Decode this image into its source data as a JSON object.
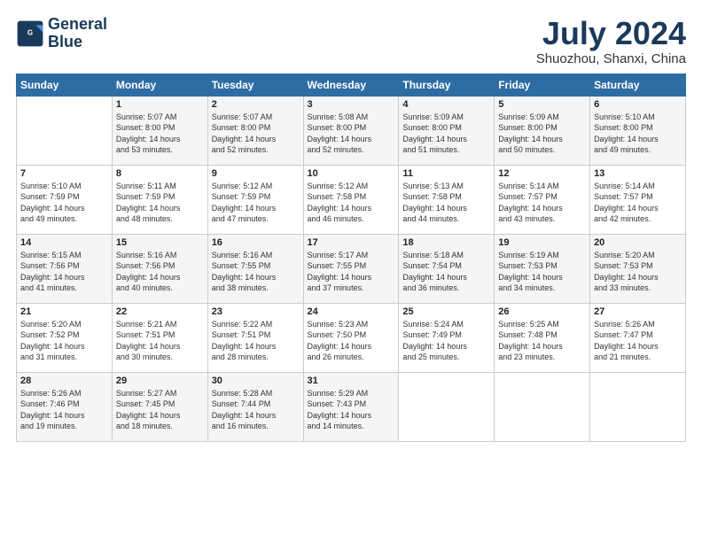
{
  "logo": {
    "line1": "General",
    "line2": "Blue"
  },
  "title": "July 2024",
  "subtitle": "Shuozhou, Shanxi, China",
  "header_days": [
    "Sunday",
    "Monday",
    "Tuesday",
    "Wednesday",
    "Thursday",
    "Friday",
    "Saturday"
  ],
  "weeks": [
    [
      {
        "num": "",
        "info": ""
      },
      {
        "num": "1",
        "info": "Sunrise: 5:07 AM\nSunset: 8:00 PM\nDaylight: 14 hours\nand 53 minutes."
      },
      {
        "num": "2",
        "info": "Sunrise: 5:07 AM\nSunset: 8:00 PM\nDaylight: 14 hours\nand 52 minutes."
      },
      {
        "num": "3",
        "info": "Sunrise: 5:08 AM\nSunset: 8:00 PM\nDaylight: 14 hours\nand 52 minutes."
      },
      {
        "num": "4",
        "info": "Sunrise: 5:09 AM\nSunset: 8:00 PM\nDaylight: 14 hours\nand 51 minutes."
      },
      {
        "num": "5",
        "info": "Sunrise: 5:09 AM\nSunset: 8:00 PM\nDaylight: 14 hours\nand 50 minutes."
      },
      {
        "num": "6",
        "info": "Sunrise: 5:10 AM\nSunset: 8:00 PM\nDaylight: 14 hours\nand 49 minutes."
      }
    ],
    [
      {
        "num": "7",
        "info": "Sunrise: 5:10 AM\nSunset: 7:59 PM\nDaylight: 14 hours\nand 49 minutes."
      },
      {
        "num": "8",
        "info": "Sunrise: 5:11 AM\nSunset: 7:59 PM\nDaylight: 14 hours\nand 48 minutes."
      },
      {
        "num": "9",
        "info": "Sunrise: 5:12 AM\nSunset: 7:59 PM\nDaylight: 14 hours\nand 47 minutes."
      },
      {
        "num": "10",
        "info": "Sunrise: 5:12 AM\nSunset: 7:58 PM\nDaylight: 14 hours\nand 46 minutes."
      },
      {
        "num": "11",
        "info": "Sunrise: 5:13 AM\nSunset: 7:58 PM\nDaylight: 14 hours\nand 44 minutes."
      },
      {
        "num": "12",
        "info": "Sunrise: 5:14 AM\nSunset: 7:57 PM\nDaylight: 14 hours\nand 43 minutes."
      },
      {
        "num": "13",
        "info": "Sunrise: 5:14 AM\nSunset: 7:57 PM\nDaylight: 14 hours\nand 42 minutes."
      }
    ],
    [
      {
        "num": "14",
        "info": "Sunrise: 5:15 AM\nSunset: 7:56 PM\nDaylight: 14 hours\nand 41 minutes."
      },
      {
        "num": "15",
        "info": "Sunrise: 5:16 AM\nSunset: 7:56 PM\nDaylight: 14 hours\nand 40 minutes."
      },
      {
        "num": "16",
        "info": "Sunrise: 5:16 AM\nSunset: 7:55 PM\nDaylight: 14 hours\nand 38 minutes."
      },
      {
        "num": "17",
        "info": "Sunrise: 5:17 AM\nSunset: 7:55 PM\nDaylight: 14 hours\nand 37 minutes."
      },
      {
        "num": "18",
        "info": "Sunrise: 5:18 AM\nSunset: 7:54 PM\nDaylight: 14 hours\nand 36 minutes."
      },
      {
        "num": "19",
        "info": "Sunrise: 5:19 AM\nSunset: 7:53 PM\nDaylight: 14 hours\nand 34 minutes."
      },
      {
        "num": "20",
        "info": "Sunrise: 5:20 AM\nSunset: 7:53 PM\nDaylight: 14 hours\nand 33 minutes."
      }
    ],
    [
      {
        "num": "21",
        "info": "Sunrise: 5:20 AM\nSunset: 7:52 PM\nDaylight: 14 hours\nand 31 minutes."
      },
      {
        "num": "22",
        "info": "Sunrise: 5:21 AM\nSunset: 7:51 PM\nDaylight: 14 hours\nand 30 minutes."
      },
      {
        "num": "23",
        "info": "Sunrise: 5:22 AM\nSunset: 7:51 PM\nDaylight: 14 hours\nand 28 minutes."
      },
      {
        "num": "24",
        "info": "Sunrise: 5:23 AM\nSunset: 7:50 PM\nDaylight: 14 hours\nand 26 minutes."
      },
      {
        "num": "25",
        "info": "Sunrise: 5:24 AM\nSunset: 7:49 PM\nDaylight: 14 hours\nand 25 minutes."
      },
      {
        "num": "26",
        "info": "Sunrise: 5:25 AM\nSunset: 7:48 PM\nDaylight: 14 hours\nand 23 minutes."
      },
      {
        "num": "27",
        "info": "Sunrise: 5:26 AM\nSunset: 7:47 PM\nDaylight: 14 hours\nand 21 minutes."
      }
    ],
    [
      {
        "num": "28",
        "info": "Sunrise: 5:26 AM\nSunset: 7:46 PM\nDaylight: 14 hours\nand 19 minutes."
      },
      {
        "num": "29",
        "info": "Sunrise: 5:27 AM\nSunset: 7:45 PM\nDaylight: 14 hours\nand 18 minutes."
      },
      {
        "num": "30",
        "info": "Sunrise: 5:28 AM\nSunset: 7:44 PM\nDaylight: 14 hours\nand 16 minutes."
      },
      {
        "num": "31",
        "info": "Sunrise: 5:29 AM\nSunset: 7:43 PM\nDaylight: 14 hours\nand 14 minutes."
      },
      {
        "num": "",
        "info": ""
      },
      {
        "num": "",
        "info": ""
      },
      {
        "num": "",
        "info": ""
      }
    ]
  ]
}
